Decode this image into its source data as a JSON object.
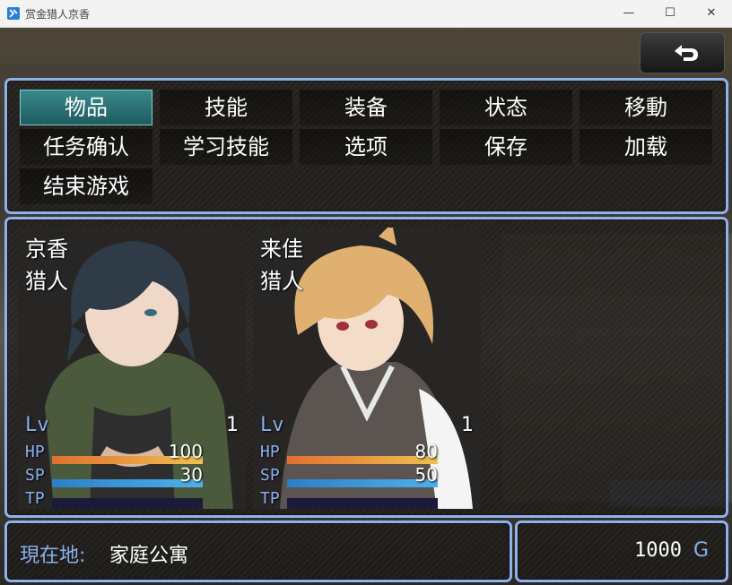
{
  "window": {
    "title": "赏金猎人京香",
    "minimize": "—",
    "maximize": "☐",
    "close": "✕"
  },
  "menu": {
    "items": [
      {
        "label": "物品",
        "selected": true
      },
      {
        "label": "技能"
      },
      {
        "label": "装备"
      },
      {
        "label": "状态"
      },
      {
        "label": "移動"
      },
      {
        "label": "任务确认"
      },
      {
        "label": "学习技能"
      },
      {
        "label": "选项"
      },
      {
        "label": "保存"
      },
      {
        "label": "加载"
      },
      {
        "label": "结束游戏"
      }
    ]
  },
  "actors": [
    {
      "name": "京香",
      "class": "猎人",
      "lv_label": "Lv",
      "level": "1",
      "hp_label": "HP",
      "hp": "100",
      "sp_label": "SP",
      "sp": "30",
      "tp_label": "TP",
      "hp_fraction": 1.0,
      "sp_fraction": 1.0,
      "tp_fraction": 0.0
    },
    {
      "name": "来佳",
      "class": "猎人",
      "lv_label": "Lv",
      "level": "1",
      "hp_label": "HP",
      "hp": "80",
      "sp_label": "SP",
      "sp": "50",
      "tp_label": "TP",
      "hp_fraction": 1.0,
      "sp_fraction": 1.0,
      "tp_fraction": 0.0
    }
  ],
  "location": {
    "label": "現在地:",
    "value": "家庭公寓"
  },
  "gold": {
    "amount": "1000",
    "unit": "G"
  },
  "colors": {
    "accent": "#8fb2ee",
    "hp": "#e8a040",
    "sp": "#3b9ad8",
    "selected": "#2e7a7e"
  }
}
